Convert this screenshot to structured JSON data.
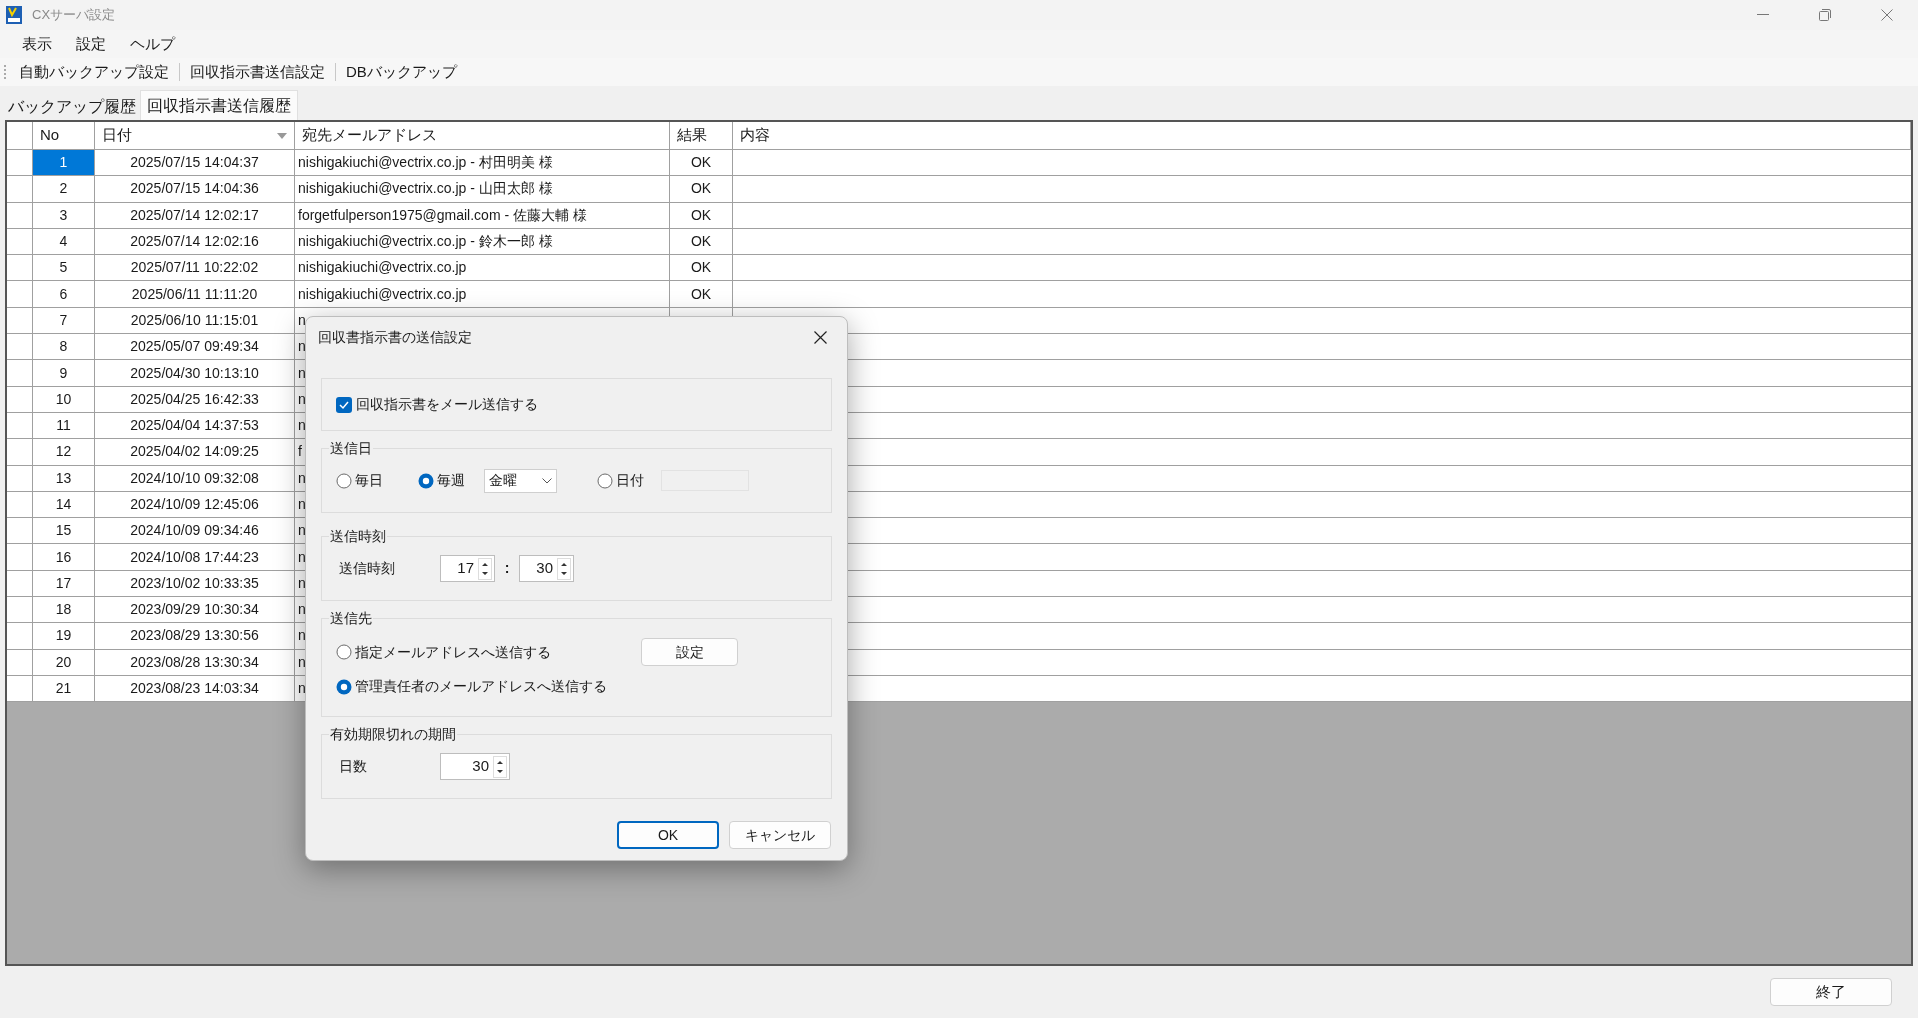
{
  "window": {
    "title": "CXサーバ設定"
  },
  "menu": [
    "表示",
    "設定",
    "ヘルプ"
  ],
  "toolbar": [
    "自動バックアップ設定",
    "回収指示書送信設定",
    "DBバックアップ"
  ],
  "tabs": [
    {
      "label": "バックアップ履歴",
      "selected": false
    },
    {
      "label": "回収指示書送信履歴",
      "selected": true
    }
  ],
  "table": {
    "columns": [
      {
        "label": "No",
        "sorted": false
      },
      {
        "label": "日付",
        "sorted": true
      },
      {
        "label": "宛先メールアドレス",
        "sorted": false
      },
      {
        "label": "結果",
        "sorted": false
      },
      {
        "label": "内容",
        "sorted": false
      }
    ],
    "rows": [
      {
        "no": "1",
        "date": "2025/07/15 14:04:37",
        "address": "nishigakiuchi@vectrix.co.jp - 村田明美 様",
        "result": "OK",
        "selected": true
      },
      {
        "no": "2",
        "date": "2025/07/15 14:04:36",
        "address": "nishigakiuchi@vectrix.co.jp - 山田太郎 様",
        "result": "OK",
        "selected": false
      },
      {
        "no": "3",
        "date": "2025/07/14 12:02:17",
        "address": "forgetfulperson1975@gmail.com - 佐藤大輔 様",
        "result": "OK",
        "selected": false
      },
      {
        "no": "4",
        "date": "2025/07/14 12:02:16",
        "address": "nishigakiuchi@vectrix.co.jp - 鈴木一郎 様",
        "result": "OK",
        "selected": false
      },
      {
        "no": "5",
        "date": "2025/07/11 10:22:02",
        "address": "nishigakiuchi@vectrix.co.jp",
        "result": "OK",
        "selected": false
      },
      {
        "no": "6",
        "date": "2025/06/11 11:11:20",
        "address": "nishigakiuchi@vectrix.co.jp",
        "result": "OK",
        "selected": false
      },
      {
        "no": "7",
        "date": "2025/06/10 11:15:01",
        "address": "n",
        "selected": false
      },
      {
        "no": "8",
        "date": "2025/05/07 09:49:34",
        "address": "n",
        "selected": false
      },
      {
        "no": "9",
        "date": "2025/04/30 10:13:10",
        "address": "n",
        "selected": false
      },
      {
        "no": "10",
        "date": "2025/04/25 16:42:33",
        "address": "n",
        "selected": false
      },
      {
        "no": "11",
        "date": "2025/04/04 14:37:53",
        "address": "n",
        "selected": false
      },
      {
        "no": "12",
        "date": "2025/04/02 14:09:25",
        "address": "f",
        "selected": false
      },
      {
        "no": "13",
        "date": "2024/10/10 09:32:08",
        "address": "n",
        "selected": false
      },
      {
        "no": "14",
        "date": "2024/10/09 12:45:06",
        "address": "n",
        "selected": false
      },
      {
        "no": "15",
        "date": "2024/10/09 09:34:46",
        "address": "n",
        "selected": false
      },
      {
        "no": "16",
        "date": "2024/10/08 17:44:23",
        "address": "n",
        "selected": false
      },
      {
        "no": "17",
        "date": "2023/10/02 10:33:35",
        "address": "n",
        "selected": false
      },
      {
        "no": "18",
        "date": "2023/09/29 10:30:34",
        "address": "n",
        "selected": false
      },
      {
        "no": "19",
        "date": "2023/08/29 13:30:56",
        "address": "n",
        "selected": false
      },
      {
        "no": "20",
        "date": "2023/08/28 13:30:34",
        "address": "n",
        "selected": false
      },
      {
        "no": "21",
        "date": "2023/08/23 14:03:34",
        "address": "n",
        "selected": false
      }
    ]
  },
  "dialog": {
    "title": "回収書指示書の送信設定",
    "enable": {
      "label": "回収指示書をメール送信する",
      "checked": true
    },
    "send_day": {
      "title": "送信日",
      "options": [
        {
          "label": "毎日",
          "selected": false,
          "kind": "plain"
        },
        {
          "label": "毎週",
          "selected": true,
          "kind": "weekday"
        },
        {
          "label": "日付",
          "selected": false,
          "kind": "date"
        }
      ],
      "weekday": "金曜",
      "date_field": {
        "disabled": true
      }
    },
    "send_time": {
      "title": "送信時刻",
      "label": "送信時刻",
      "hour": "17",
      "separator": ":",
      "minute": "30"
    },
    "recipient": {
      "title": "送信先",
      "options": [
        {
          "label": "指定メールアドレスへ送信する",
          "selected": false
        },
        {
          "label": "管理責任者のメールアドレスへ送信する",
          "selected": true
        }
      ],
      "settings_button": "設定"
    },
    "expiry": {
      "title": "有効期限切れの期間",
      "label": "日数",
      "days": "30"
    },
    "buttons": [
      {
        "label": "OK",
        "default": true
      },
      {
        "label": "キャンセル",
        "default": false
      }
    ]
  },
  "footer": {
    "button": "終了"
  }
}
